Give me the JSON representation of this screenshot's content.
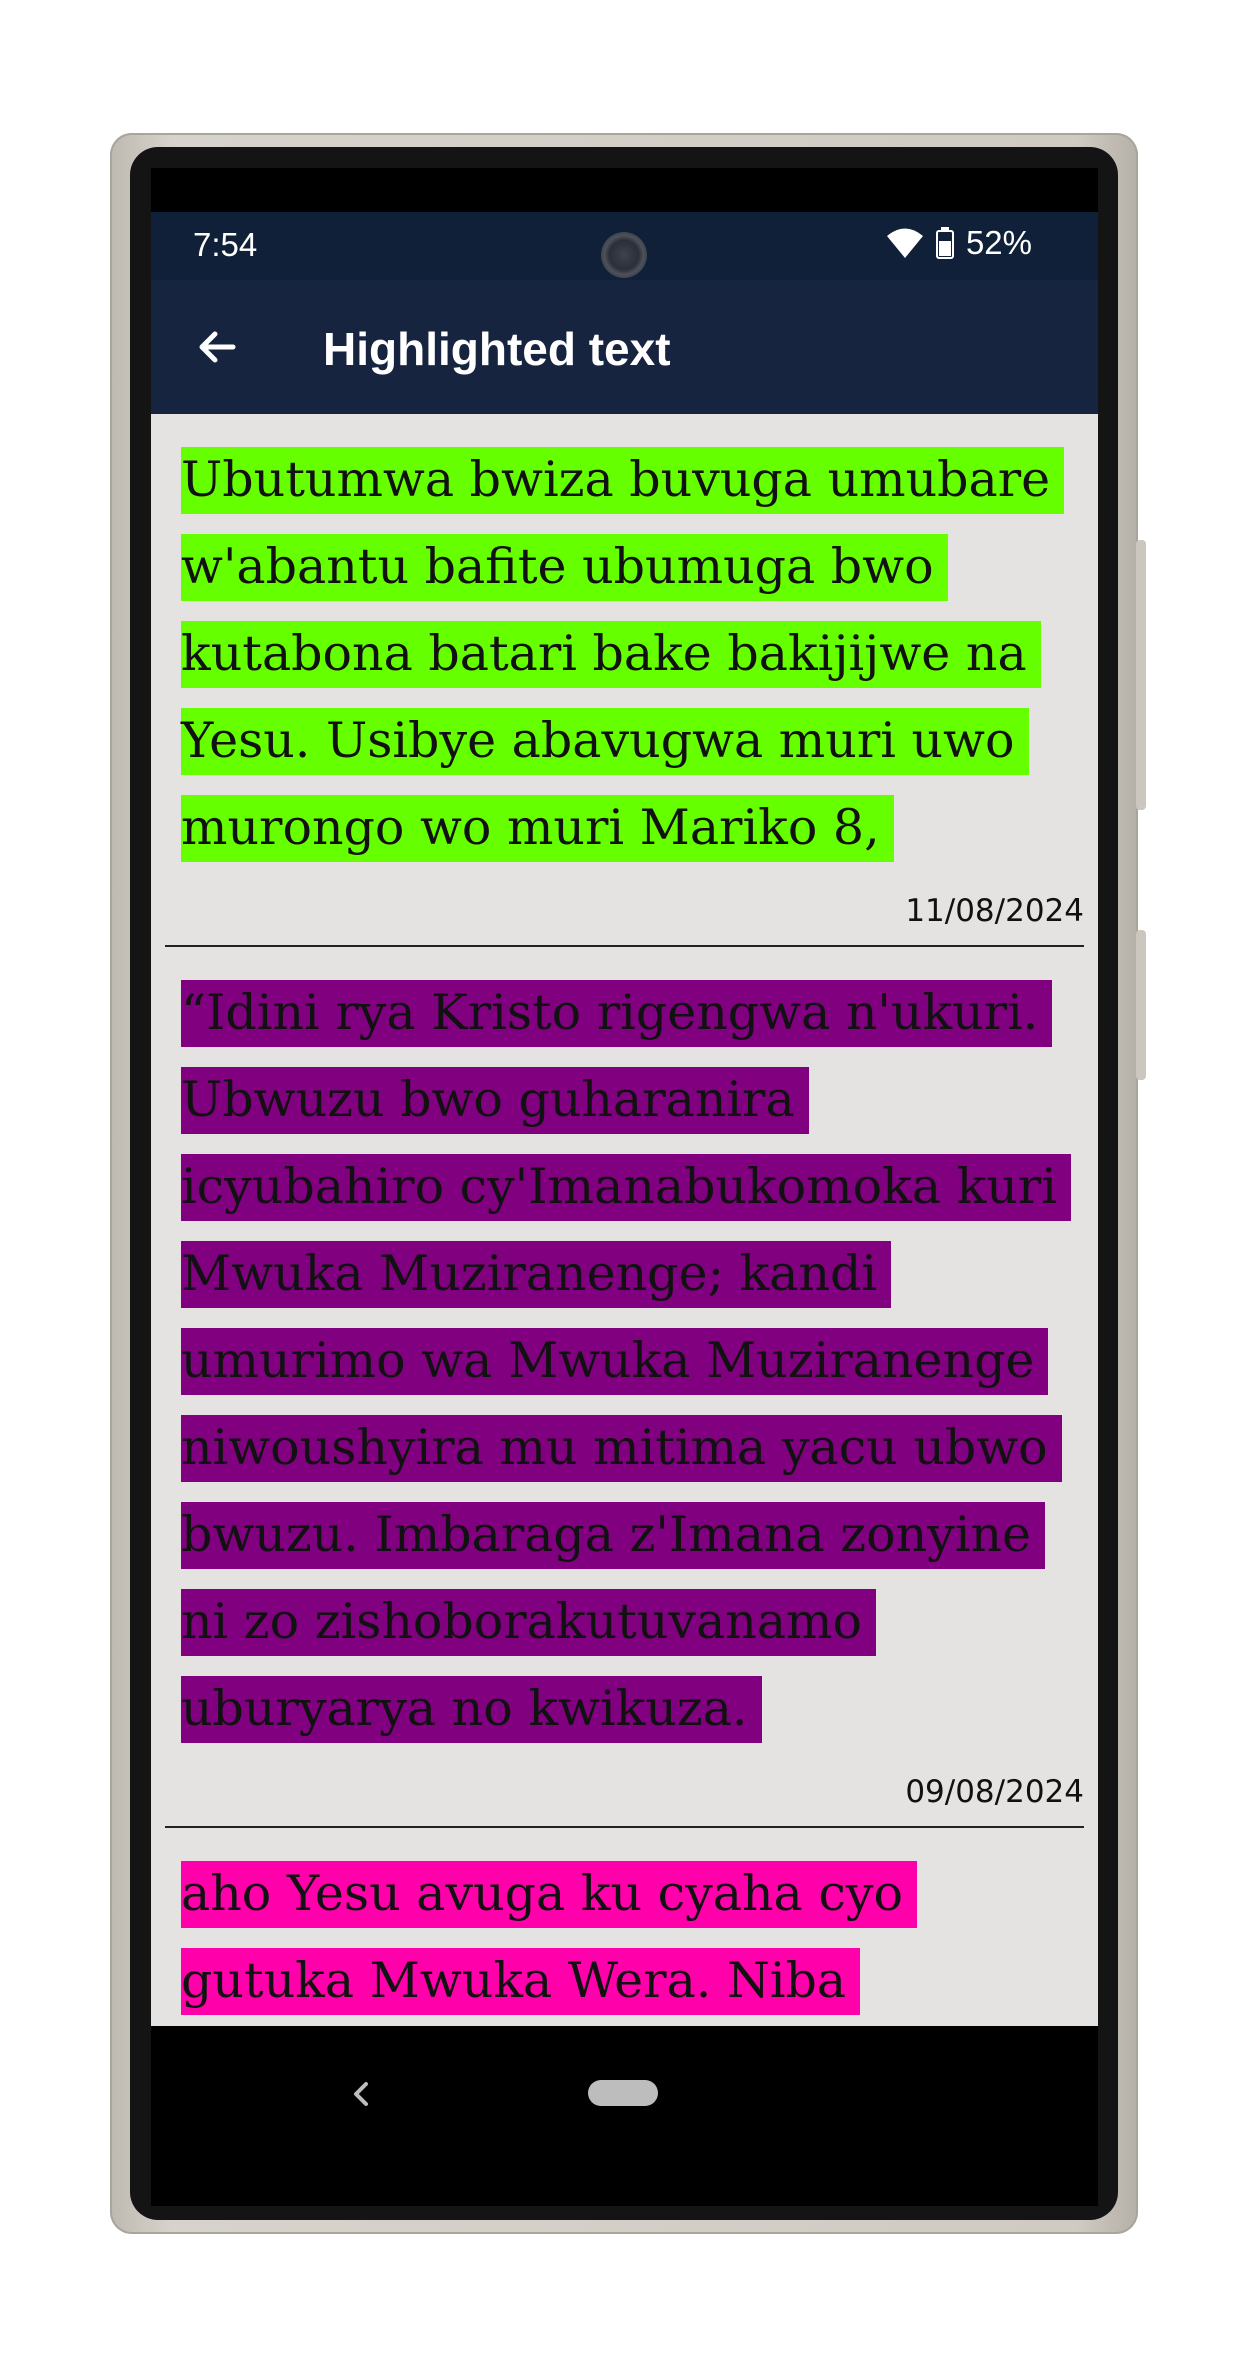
{
  "status_bar": {
    "time": "7:54",
    "battery": "52%"
  },
  "app_bar": {
    "title": "Highlighted text"
  },
  "entries": [
    {
      "text": "Ubutumwa bwiza buvuga umubare w'abantu bafite ubumuga bwo kutabona batari bake bakijijwe na Yesu. Usibye abavugwa muri uwo murongo wo muri Mariko 8,",
      "date": "11/08/2024",
      "color": "#66ff00"
    },
    {
      "text": "“Idini rya Kristo rigengwa n'ukuri. Ubwuzu bwo guharanira icyubahiro cy'Imanabukomoka kuri Mwuka Muziranenge; kandi umurimo wa Mwuka Muziranenge niwoushyira mu mitima yacu ubwo bwuzu. Imbaraga z'Imana zonyine ni zo zishoborakutuvanamo uburyarya no kwikuza.",
      "date": "09/08/2024",
      "color": "#800080"
    },
    {
      "text": "aho Yesu avuga ku cyaha cyo gutuka Mwuka Wera. Niba amatwiy'umuntu atumva",
      "date": "",
      "color": "#ff00aa"
    }
  ],
  "icons": {
    "back": "arrow-left",
    "wifi": "wifi",
    "battery": "battery",
    "nav_back": "chevron-left",
    "nav_home": "home-pill"
  }
}
